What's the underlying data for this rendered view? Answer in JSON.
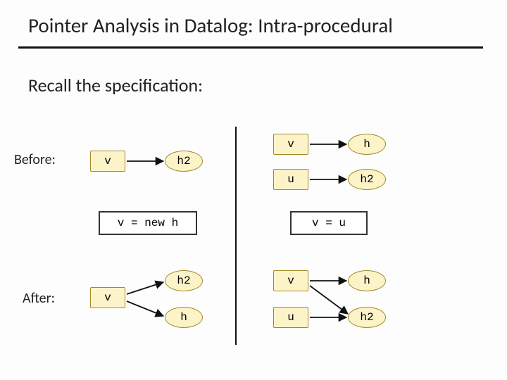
{
  "title": "Pointer Analysis in Datalog: Intra-procedural",
  "subtitle": "Recall the specification:",
  "labels": {
    "before": "Before:",
    "after": "After:"
  },
  "left": {
    "before": {
      "v": "v",
      "h2": "h2"
    },
    "stmt": "v = new h",
    "after": {
      "v": "v",
      "h2": "h2",
      "h": "h"
    }
  },
  "right": {
    "before": {
      "v": "v",
      "h": "h",
      "u": "u",
      "h2": "h2"
    },
    "stmt": "v = u",
    "after": {
      "v": "v",
      "h": "h",
      "u": "u",
      "h2": "h2"
    }
  }
}
